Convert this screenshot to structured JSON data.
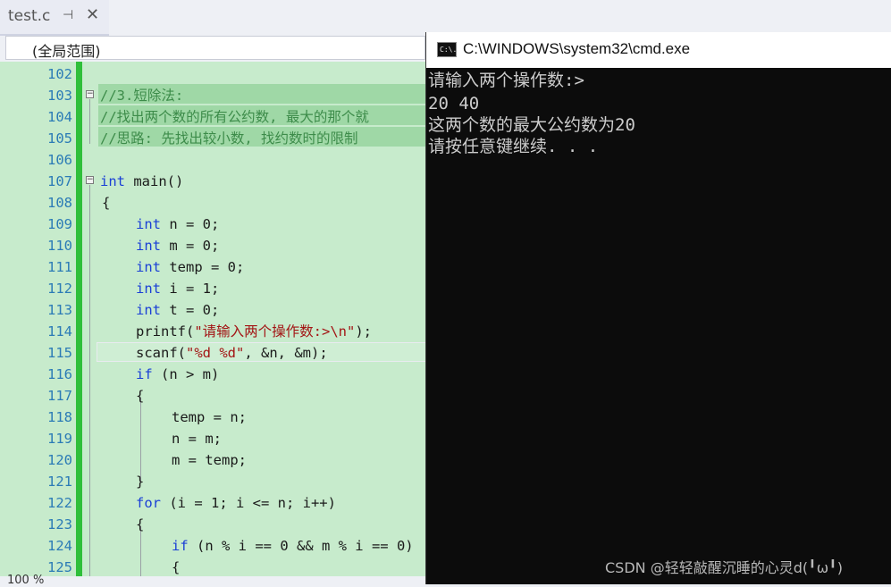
{
  "editor": {
    "tab_label": "test.c",
    "tab_pin_glyph": "⊣",
    "tab_close_glyph": "✕",
    "scope_label": "(全局范围)",
    "zoom_label": "100 %",
    "line_numbers": [
      "102",
      "103",
      "104",
      "105",
      "106",
      "107",
      "108",
      "109",
      "110",
      "111",
      "112",
      "113",
      "114",
      "115",
      "116",
      "117",
      "118",
      "119",
      "120",
      "121",
      "122",
      "123",
      "124",
      "125"
    ],
    "code": {
      "l103": "//3.短除法:",
      "l104": "//找出两个数的所有公约数, 最大的那个就",
      "l105": "//思路: 先找出较小数, 找约数时的限制",
      "l107_kw": "int",
      "l107_rest": " main()",
      "l108": "{",
      "l109_kw": "int",
      "l109_rest": " n = 0;",
      "l110_kw": "int",
      "l110_rest": " m = 0;",
      "l111_kw": "int",
      "l111_rest": " temp = 0;",
      "l112_kw": "int",
      "l112_rest": " i = 1;",
      "l113_kw": "int",
      "l113_rest": " t = 0;",
      "l114_a": "printf(",
      "l114_str": "\"请输入两个操作数:>\\n\"",
      "l114_b": ");",
      "l115_a": "scanf(",
      "l115_str": "\"%d %d\"",
      "l115_b": ", &n, &m);",
      "l116_kw": "if",
      "l116_rest": " (n > m)",
      "l117": "{",
      "l118": "temp = n;",
      "l119": "n = m;",
      "l120": "m = temp;",
      "l121": "}",
      "l122_kw": "for",
      "l122_rest": " (i = 1; i <= n; i++)",
      "l123": "{",
      "l124_kw": "if",
      "l124_rest": " (n % i == 0 && m % i == 0)",
      "l125": "{"
    },
    "fold_glyph": "−"
  },
  "console": {
    "icon_text": "C:\\.",
    "title": "C:\\WINDOWS\\system32\\cmd.exe",
    "lines": [
      "请输入两个操作数:>",
      "20 40",
      "这两个数的最大公约数为20",
      "请按任意键继续. . ."
    ]
  },
  "watermark": "CSDN @轻轻敲醒沉睡的心灵d(╹ω╹)",
  "colors": {
    "editor_bg": "#c7ebcc",
    "keyword": "#1a3fd6",
    "string": "#a31515",
    "comment": "#3d8c4a",
    "console_bg": "#0c0c0c",
    "console_text": "#cccccc"
  }
}
